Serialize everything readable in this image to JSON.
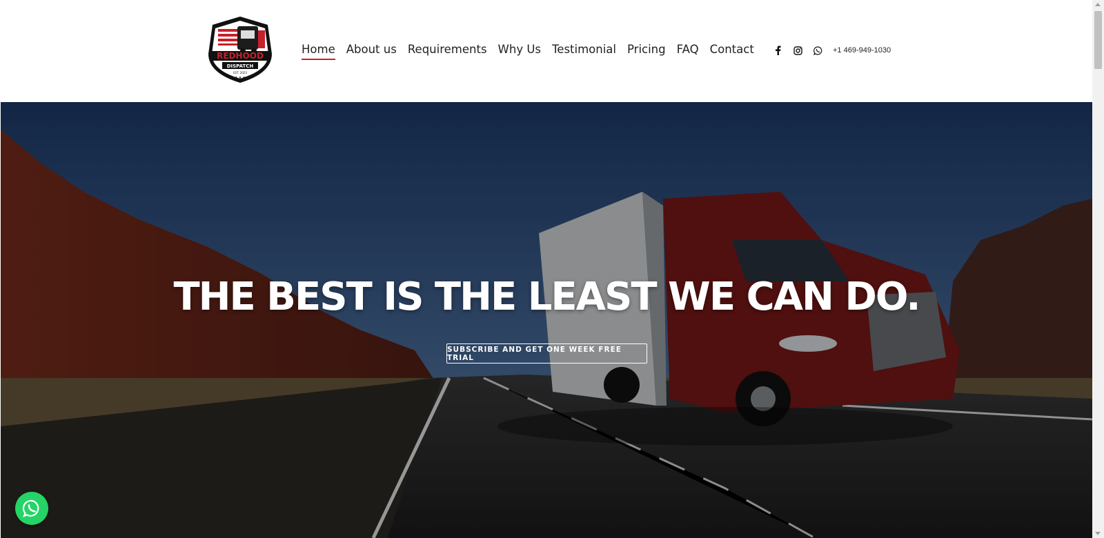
{
  "brand": {
    "logo_line1": "REDHOOD",
    "logo_line2": "DISPATCH",
    "logo_line3": "EST. 2023"
  },
  "nav": {
    "items": [
      {
        "label": "Home",
        "active": true
      },
      {
        "label": "About us",
        "active": false
      },
      {
        "label": "Requirements",
        "active": false
      },
      {
        "label": "Why Us",
        "active": false
      },
      {
        "label": "Testimonial",
        "active": false
      },
      {
        "label": "Pricing",
        "active": false
      },
      {
        "label": "FAQ",
        "active": false
      },
      {
        "label": "Contact",
        "active": false
      }
    ]
  },
  "social": {
    "icons": [
      "facebook-icon",
      "instagram-icon",
      "whatsapp-icon"
    ],
    "phone": "+1 469-949-1030"
  },
  "hero": {
    "title": "THE BEST IS THE LEAST WE CAN DO.",
    "cta_label": "SUBSCRIBE AND GET ONE WEEK FREE TRIAL"
  },
  "colors": {
    "accent": "#c8202a",
    "whatsapp": "#25d366",
    "nav_text": "#222222"
  }
}
